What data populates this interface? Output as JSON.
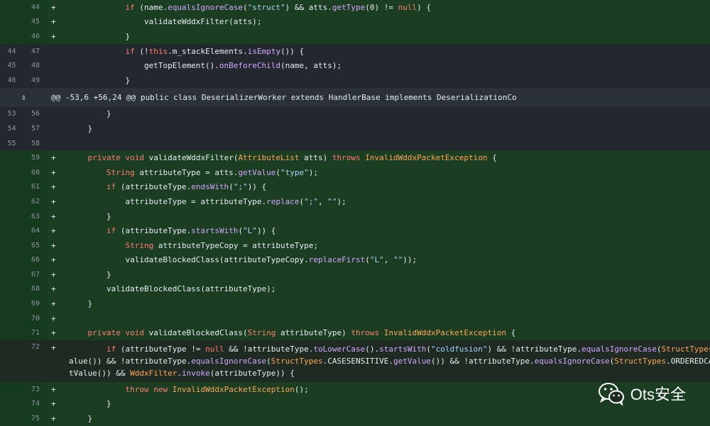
{
  "diff": {
    "rows": [
      {
        "type": "add",
        "old": "",
        "new": "44",
        "mark": "+",
        "code": "            if (name.equalsIgnoreCase(\"struct\") && atts.getType(0) != null) {"
      },
      {
        "type": "add",
        "old": "",
        "new": "45",
        "mark": "+",
        "code": "                validateWddxFilter(atts);"
      },
      {
        "type": "add",
        "old": "",
        "new": "46",
        "mark": "+",
        "code": "            }"
      },
      {
        "type": "ctx",
        "old": "44",
        "new": "47",
        "mark": "",
        "code": "            if (!this.m_stackElements.isEmpty()) {"
      },
      {
        "type": "ctx",
        "old": "45",
        "new": "48",
        "mark": "",
        "code": "                getTopElement().onBeforeChild(name, atts);"
      },
      {
        "type": "ctx",
        "old": "46",
        "new": "49",
        "mark": "",
        "code": "            }"
      },
      {
        "type": "hunk",
        "old": "",
        "new": "",
        "mark": "",
        "code": "@@ -53,6 +56,24 @@ public class DeserializerWorker extends HandlerBase implements DeserializationCo"
      },
      {
        "type": "ctx",
        "old": "53",
        "new": "56",
        "mark": "",
        "code": "        }"
      },
      {
        "type": "ctx",
        "old": "54",
        "new": "57",
        "mark": "",
        "code": "    }"
      },
      {
        "type": "ctx",
        "old": "55",
        "new": "58",
        "mark": "",
        "code": ""
      },
      {
        "type": "add",
        "old": "",
        "new": "59",
        "mark": "+",
        "code": "    private void validateWddxFilter(AttributeList atts) throws InvalidWddxPacketException {"
      },
      {
        "type": "add",
        "old": "",
        "new": "60",
        "mark": "+",
        "code": "        String attributeType = atts.getValue(\"type\");"
      },
      {
        "type": "add",
        "old": "",
        "new": "61",
        "mark": "+",
        "code": "        if (attributeType.endsWith(\";\")) {"
      },
      {
        "type": "add",
        "old": "",
        "new": "62",
        "mark": "+",
        "code": "            attributeType = attributeType.replace(\";\", \"\");"
      },
      {
        "type": "add",
        "old": "",
        "new": "63",
        "mark": "+",
        "code": "        }"
      },
      {
        "type": "add",
        "old": "",
        "new": "64",
        "mark": "+",
        "code": "        if (attributeType.startsWith(\"L\")) {"
      },
      {
        "type": "add",
        "old": "",
        "new": "65",
        "mark": "+",
        "code": "            String attributeTypeCopy = attributeType;"
      },
      {
        "type": "add",
        "old": "",
        "new": "66",
        "mark": "+",
        "code": "            validateBlockedClass(attributeTypeCopy.replaceFirst(\"L\", \"\"));"
      },
      {
        "type": "add",
        "old": "",
        "new": "67",
        "mark": "+",
        "code": "        }"
      },
      {
        "type": "add",
        "old": "",
        "new": "68",
        "mark": "+",
        "code": "        validateBlockedClass(attributeType);"
      },
      {
        "type": "add",
        "old": "",
        "new": "69",
        "mark": "+",
        "code": "    }"
      },
      {
        "type": "add",
        "old": "",
        "new": "70",
        "mark": "+",
        "code": ""
      },
      {
        "type": "add",
        "old": "",
        "new": "71",
        "mark": "+",
        "code": "    private void validateBlockedClass(String attributeType) throws InvalidWddxPacketException {"
      },
      {
        "type": "tall",
        "old": "",
        "new": "72",
        "mark": "+",
        "code": "        if (attributeType != null && !attributeType.toLowerCase().startsWith(\"coldfusion\") && !attributeType.equalsIgnoreCase(StructTypes.ORDERED.getV\nalue()) && !attributeType.equalsIgnoreCase(StructTypes.CASESENSITIVE.getValue()) && !attributeType.equalsIgnoreCase(StructTypes.ORDEREDCASESENSITIVE.ge\ntValue()) && WddxFilter.invoke(attributeType)) {"
      },
      {
        "type": "add",
        "old": "",
        "new": "73",
        "mark": "+",
        "code": "            throw new InvalidWddxPacketException();"
      },
      {
        "type": "add",
        "old": "",
        "new": "74",
        "mark": "+",
        "code": "        }"
      },
      {
        "type": "add",
        "old": "",
        "new": "75",
        "mark": "+",
        "code": "    }"
      }
    ],
    "expand_icon": "unfold-icon"
  },
  "watermark": {
    "icon": "wechat-icon",
    "text": "Ots安全"
  },
  "colors": {
    "added_bg": "#1b3d22",
    "context_bg": "#23272e",
    "hunk_bg": "#2a3138"
  }
}
